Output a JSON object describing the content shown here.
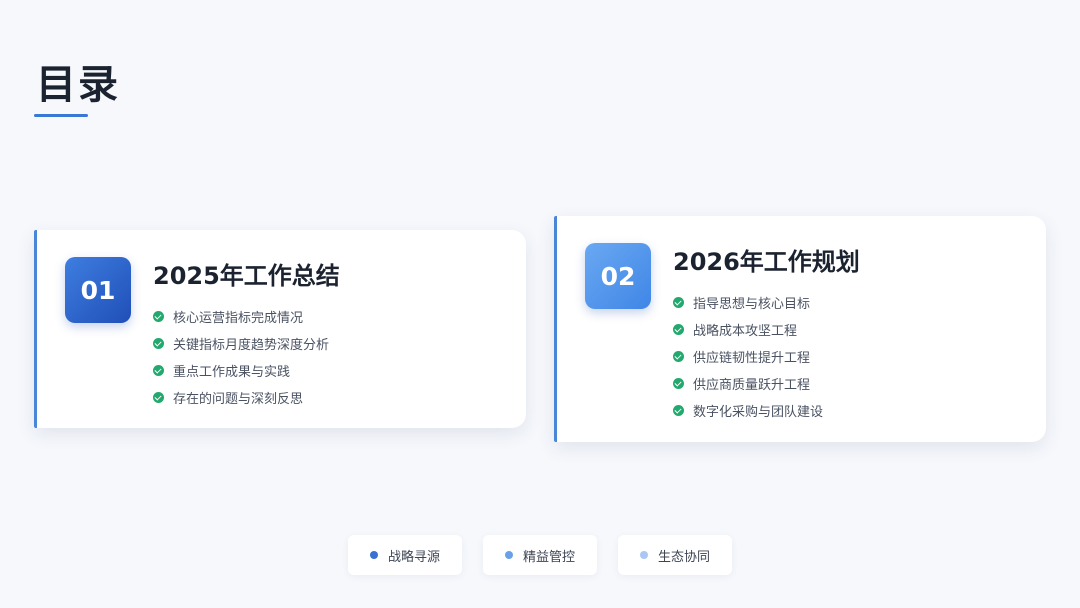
{
  "header": {
    "title": "目录"
  },
  "sections": [
    {
      "number": "01",
      "title": "2025年工作总结",
      "items": [
        "核心运营指标完成情况",
        "关键指标月度趋势深度分析",
        "重点工作成果与实践",
        "存在的问题与深刻反思"
      ]
    },
    {
      "number": "02",
      "title": "2026年工作规划",
      "items": [
        "指导思想与核心目标",
        "战略成本攻坚工程",
        "供应链韧性提升工程",
        "供应商质量跃升工程",
        "数字化采购与团队建设"
      ]
    }
  ],
  "tags": [
    {
      "label": "战略寻源",
      "color": "#3a6fd6"
    },
    {
      "label": "精益管控",
      "color": "#6aa0e8"
    },
    {
      "label": "生态协同",
      "color": "#a9c8f2"
    }
  ],
  "colors": {
    "accent": "#3a78d6",
    "check": "#23a86e",
    "background": "#f6f8fc"
  }
}
